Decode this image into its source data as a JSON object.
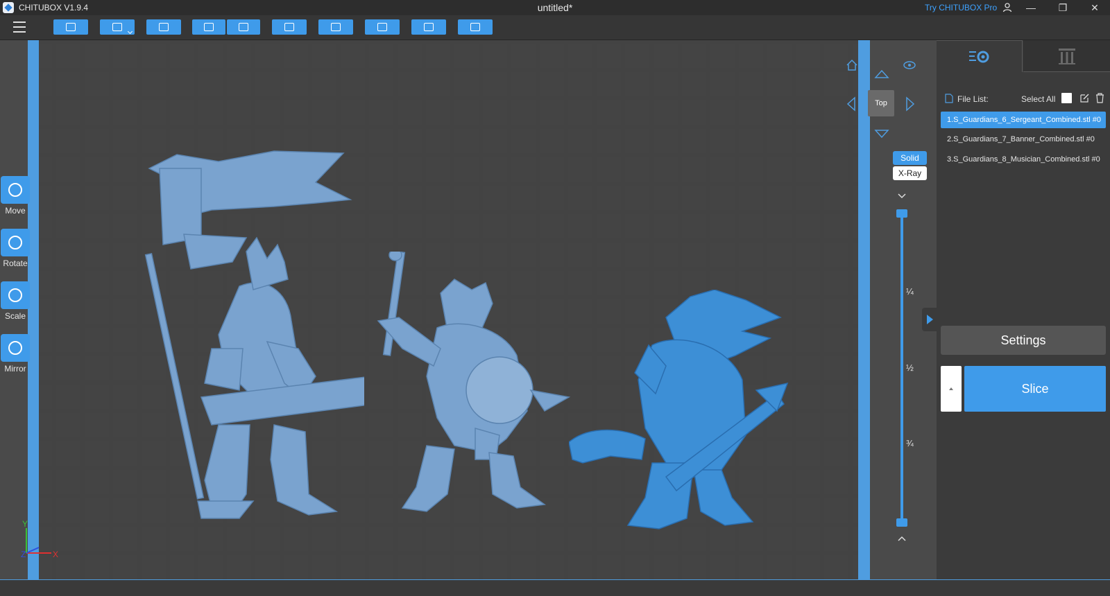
{
  "window": {
    "app_name": "CHITUBOX V1.9.4",
    "doc_title": "untitled*",
    "try_pro": "Try CHITUBOX Pro",
    "controls": [
      "—",
      "❐",
      "✕"
    ]
  },
  "toolbar": {
    "buttons": [
      "open-file",
      "save",
      "auto-layout",
      "undo",
      "redo",
      "duplicate",
      "arrange",
      "support",
      "hollow",
      "repair"
    ]
  },
  "tools": [
    {
      "label": "Move"
    },
    {
      "label": "Rotate"
    },
    {
      "label": "Scale"
    },
    {
      "label": "Mirror"
    }
  ],
  "view": {
    "top_label": "Top",
    "solid_label": "Solid",
    "xray_label": "X-Ray",
    "active_mode": "Solid"
  },
  "slider": {
    "quarter": "¼",
    "half": "½",
    "three_quarter": "¾",
    "upper_level": 1.0,
    "lower_level": 0.0
  },
  "panel": {
    "file_list_label": "File List:",
    "select_all_label": "Select All",
    "files": [
      "1.S_Guardians_6_Sergeant_Combined.stl #0",
      "2.S_Guardians_7_Banner_Combined.stl #0",
      "3.S_Guardians_8_Musician_Combined.stl #0"
    ],
    "selected_index": 0,
    "settings_label": "Settings",
    "slice_label": "Slice"
  },
  "axes": {
    "x": "X",
    "y": "Y",
    "z": "Z"
  },
  "colors": {
    "accent": "#3f9bea",
    "model": "#7aa3cf",
    "selected_model": "#3d8fd6",
    "plate": "#555555",
    "panel": "#3b3b3b"
  }
}
